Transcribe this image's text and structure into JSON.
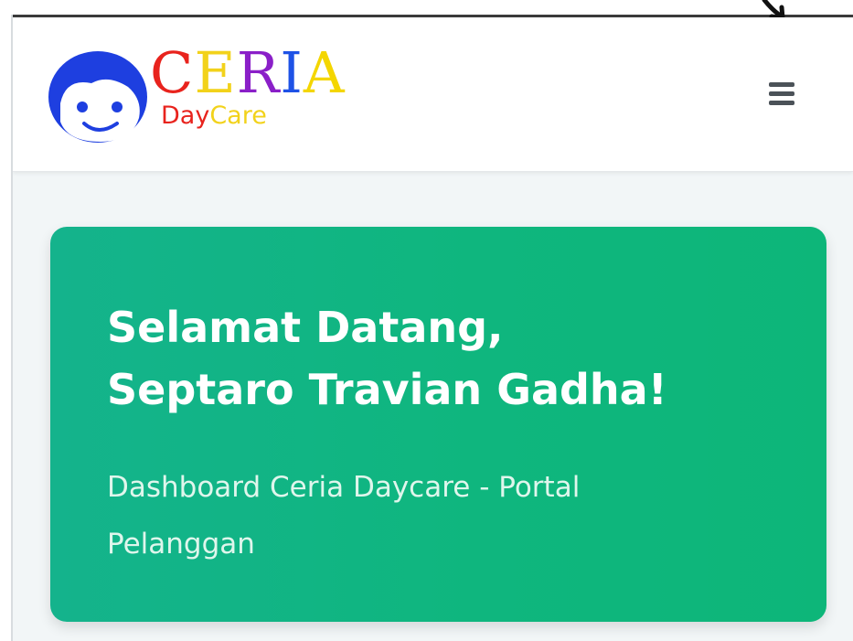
{
  "brand": {
    "name_letters": [
      {
        "char": "C",
        "color": "#e8231d"
      },
      {
        "char": "E",
        "color": "#f2d21b"
      },
      {
        "char": "R",
        "color": "#8a1fc8"
      },
      {
        "char": "I",
        "color": "#1e52e6"
      },
      {
        "char": "A",
        "color": "#f4d600"
      }
    ],
    "sub_part1": "Day",
    "sub_part2": "Care",
    "sub_color1": "#e8231d",
    "sub_color2": "#f2d21b",
    "face_color": "#1e3fe0"
  },
  "navbar": {
    "menu_icon": "hamburger-icon"
  },
  "hero": {
    "greeting": "Selamat Datang,",
    "user_name": "Septaro Travian Gadha!",
    "subtitle_line1": "Dashboard Ceria Daycare - Portal",
    "subtitle_line2": "Pelanggan",
    "gradient_start": "#14b38c",
    "gradient_end": "#0db679"
  }
}
